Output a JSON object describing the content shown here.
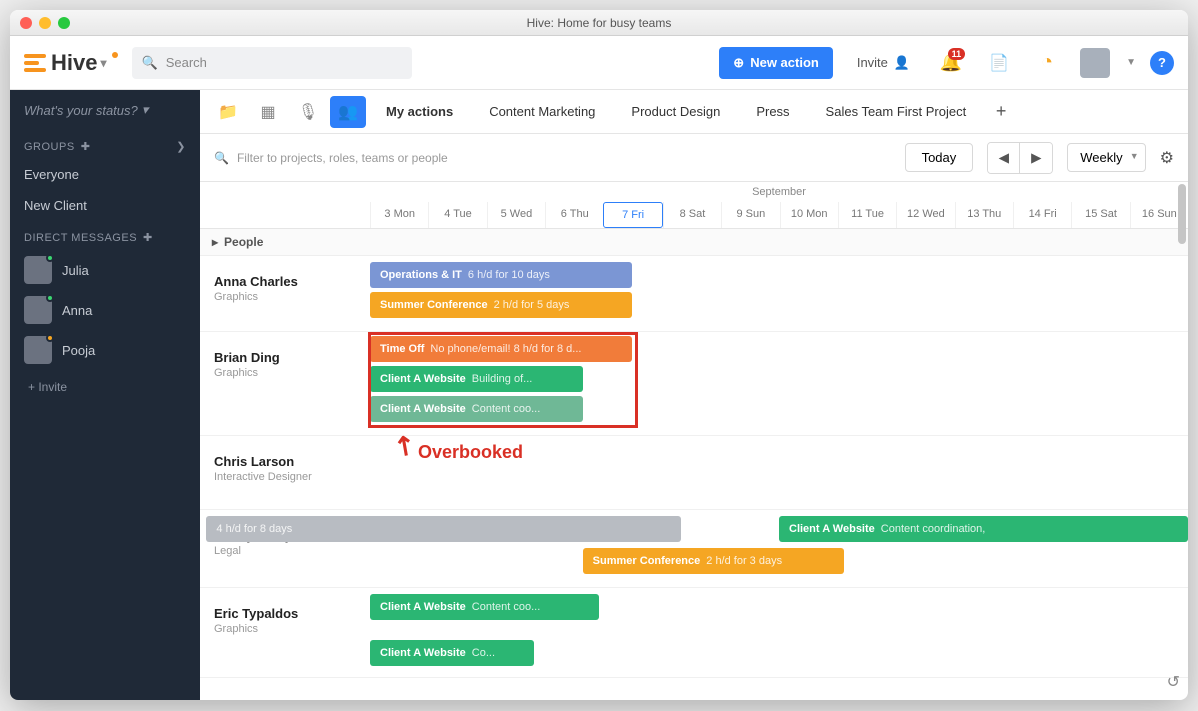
{
  "window": {
    "title": "Hive: Home for busy teams"
  },
  "brand": {
    "name": "Hive"
  },
  "search": {
    "placeholder": "Search"
  },
  "actions": {
    "new_action": "New action",
    "invite": "Invite",
    "notif_count": "11"
  },
  "sidebar": {
    "status_placeholder": "What's your status?",
    "groups_header": "GROUPS",
    "groups": [
      "Everyone",
      "New Client"
    ],
    "dm_header": "DIRECT MESSAGES",
    "dms": [
      {
        "name": "Julia",
        "presence": "#3bd671"
      },
      {
        "name": "Anna",
        "presence": "#3bd671"
      },
      {
        "name": "Pooja",
        "presence": "#f5a623"
      }
    ],
    "invite": "+ Invite"
  },
  "tabs": {
    "items": [
      "My actions",
      "Content Marketing",
      "Product Design",
      "Press",
      "Sales Team First Project"
    ]
  },
  "filter": {
    "placeholder": "Filter to projects, roles, teams or people",
    "today": "Today",
    "view": "Weekly"
  },
  "calendar": {
    "month": "September",
    "days": [
      "3 Mon",
      "4 Tue",
      "5 Wed",
      "6 Thu",
      "7 Fri",
      "8 Sat",
      "9 Sun",
      "10 Mon",
      "11 Tue",
      "12 Wed",
      "13 Thu",
      "14 Fri",
      "15 Sat",
      "16 Sun"
    ],
    "current_index": 4,
    "section": "People"
  },
  "people": [
    {
      "name": "Anna Charles",
      "role": "Graphics"
    },
    {
      "name": "Brian Ding",
      "role": "Graphics"
    },
    {
      "name": "Chris Larson",
      "role": "Interactive Designer"
    },
    {
      "name": "Danny Curry",
      "role": "Legal"
    },
    {
      "name": "Eric Typaldos",
      "role": "Graphics"
    }
  ],
  "bars": {
    "anna": [
      {
        "title": "Operations & IT",
        "sub": "6 h/d for 10 days"
      },
      {
        "title": "Summer Conference",
        "sub": "2 h/d for 5 days"
      }
    ],
    "brian": [
      {
        "title": "Time Off",
        "sub": "No phone/email! 8 h/d for 8 d..."
      },
      {
        "title": "Client A Website",
        "sub": "Building of..."
      },
      {
        "title": "Client A Website",
        "sub": "Content coo..."
      }
    ],
    "danny": [
      {
        "title": "",
        "sub": "4 h/d for 8 days"
      },
      {
        "title": "Client A Website",
        "sub": "Content coordination,"
      },
      {
        "title": "Summer Conference",
        "sub": "2 h/d for 3 days"
      }
    ],
    "eric": [
      {
        "title": "Client A Website",
        "sub": "Content coo..."
      },
      {
        "title": "Client A Website",
        "sub": "Co..."
      }
    ]
  },
  "annotation": {
    "label": "Overbooked"
  }
}
